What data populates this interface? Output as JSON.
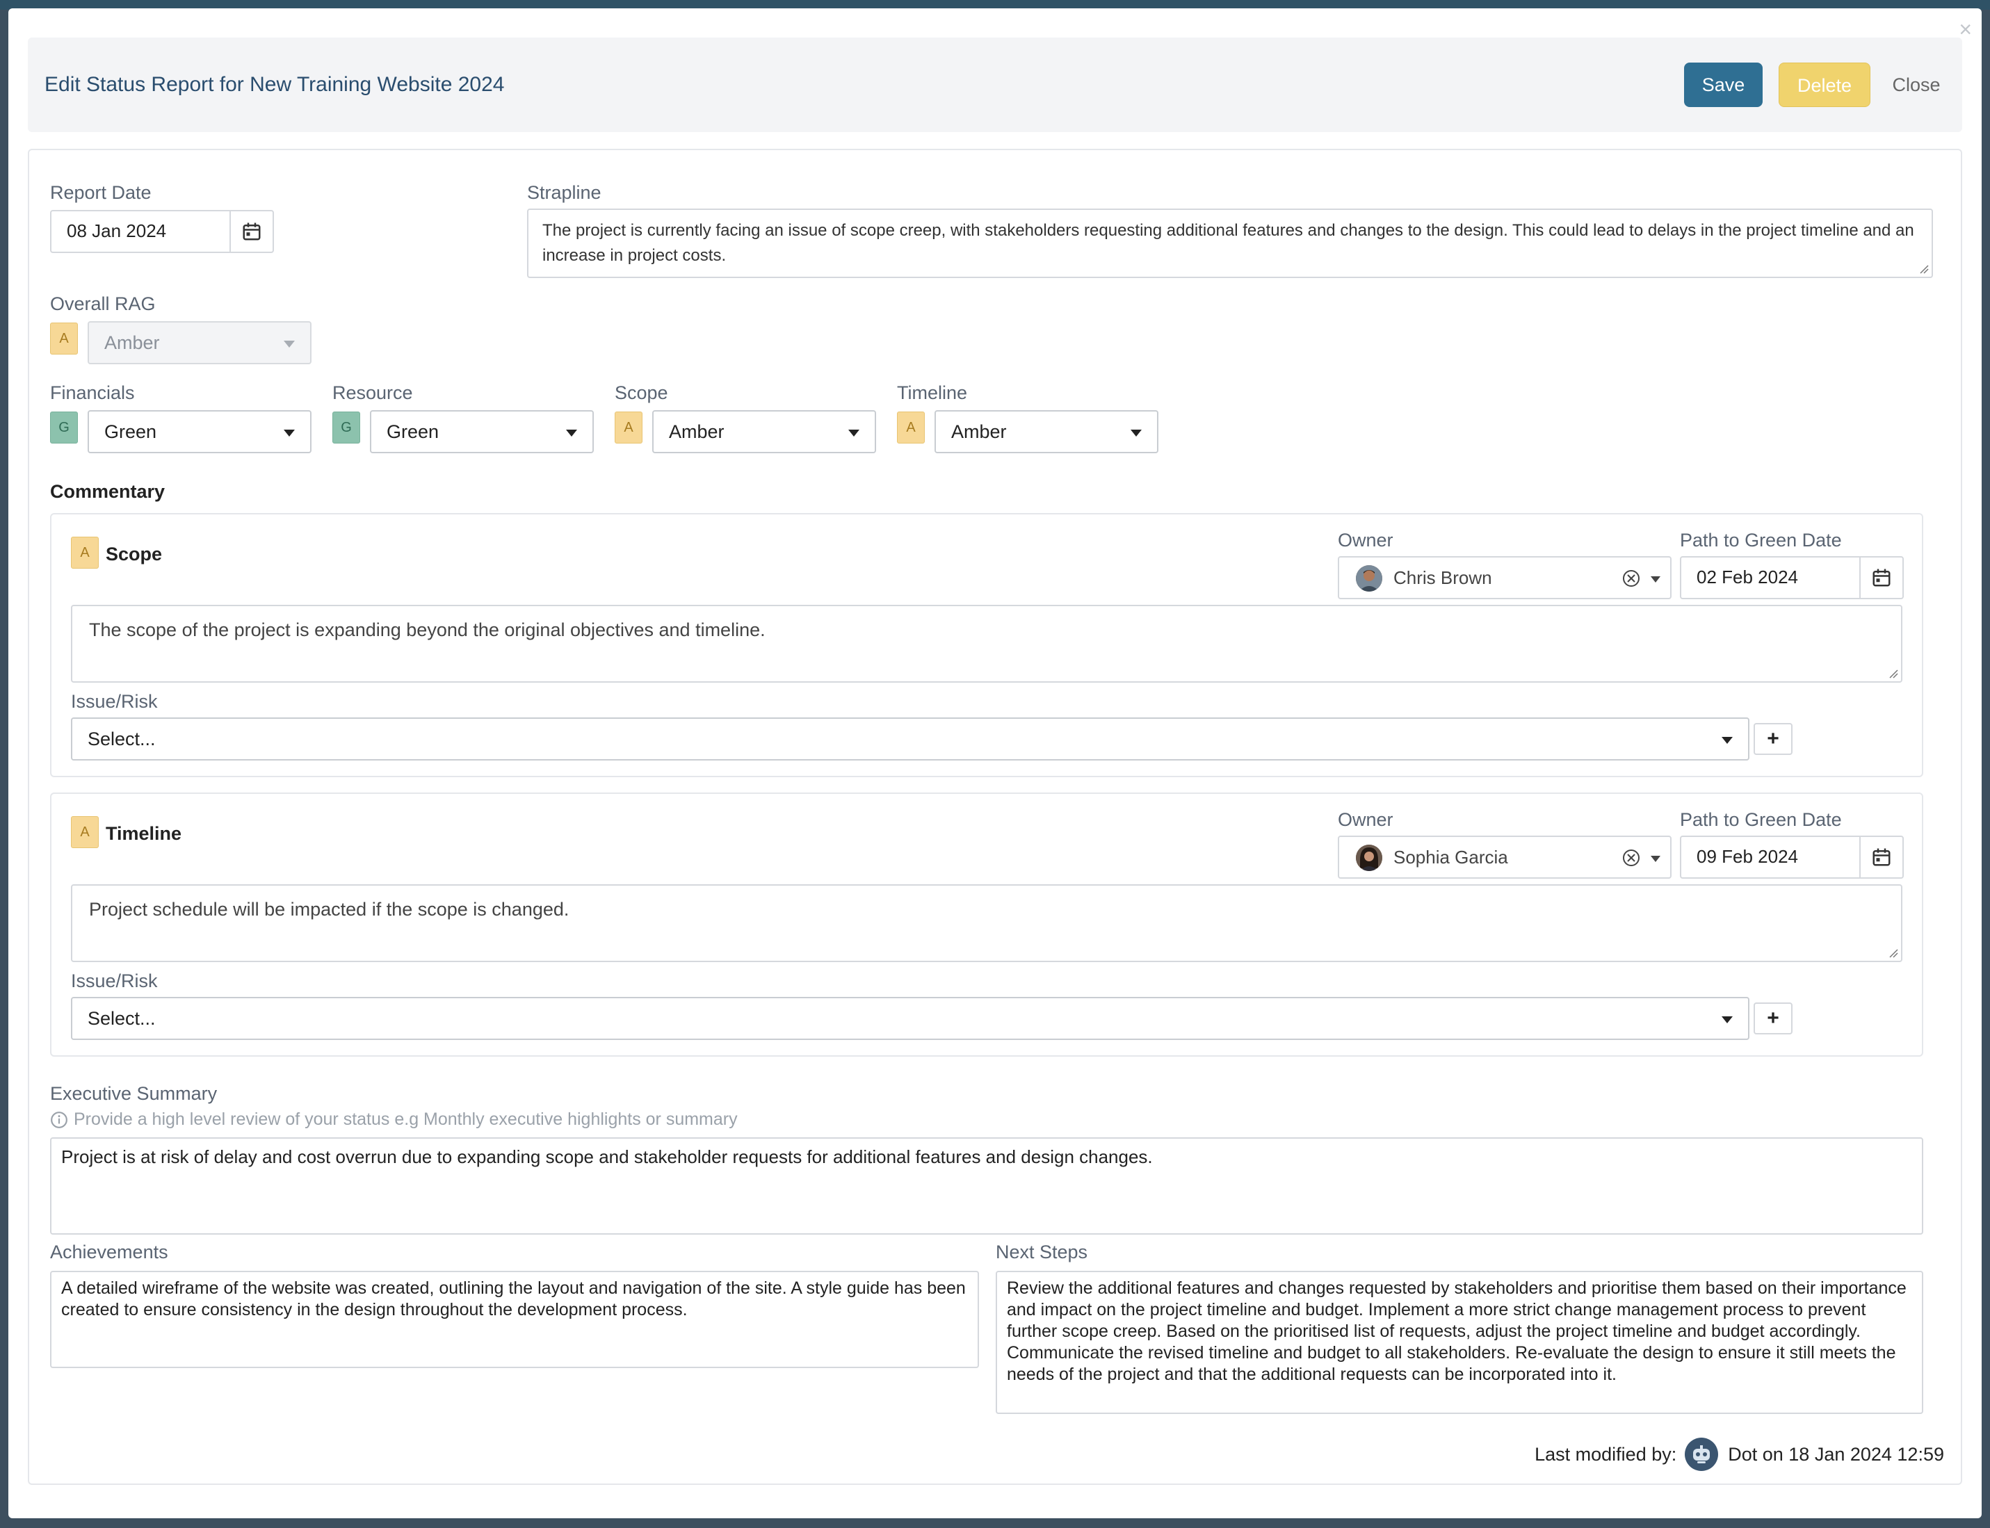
{
  "modal": {
    "title": "Edit Status Report for New Training Website 2024",
    "save_label": "Save",
    "delete_label": "Delete",
    "close_label": "Close",
    "close_icon": "×"
  },
  "report": {
    "report_date_label": "Report Date",
    "report_date_value": "08 Jan 2024",
    "strapline_label": "Strapline",
    "strapline_value": "The project is currently facing an issue of scope creep, with stakeholders requesting additional features and changes to the design. This could lead to delays in the project timeline and an increase in project costs.",
    "overall_rag_label": "Overall RAG",
    "overall_rag_badge": "A",
    "overall_rag_value": "Amber"
  },
  "rags": [
    {
      "label": "Financials",
      "badge": "G",
      "value": "Green"
    },
    {
      "label": "Resource",
      "badge": "G",
      "value": "Green"
    },
    {
      "label": "Scope",
      "badge": "A",
      "value": "Amber"
    },
    {
      "label": "Timeline",
      "badge": "A",
      "value": "Amber"
    }
  ],
  "commentary": {
    "heading": "Commentary",
    "owner_label": "Owner",
    "path_label": "Path to Green Date",
    "issue_label": "Issue/Risk",
    "issue_placeholder": "Select...",
    "plus": "+",
    "items": [
      {
        "badge": "A",
        "title": "Scope",
        "owner": "Chris Brown",
        "path_date": "02 Feb 2024",
        "comment": "The scope of the project is expanding beyond the original objectives and timeline."
      },
      {
        "badge": "A",
        "title": "Timeline",
        "owner": "Sophia Garcia",
        "path_date": "09 Feb 2024",
        "comment": "Project schedule will be impacted if the scope is changed."
      }
    ]
  },
  "summary": {
    "exec_label": "Executive Summary",
    "exec_hint": "Provide a high level review of your status e.g Monthly executive highlights or summary",
    "exec_value": "Project is at risk of delay and cost overrun due to expanding scope and stakeholder requests for additional features and design changes.",
    "achievements_label": "Achievements",
    "achievements_value": "A detailed wireframe of the website was created, outlining the layout and navigation of the site. A style guide has been created to ensure consistency in the design throughout the development process.",
    "next_steps_label": "Next Steps",
    "next_steps_value": "Review the additional features and changes requested by stakeholders and prioritise them based on their importance and impact on the project timeline and budget. Implement a more strict change management process to prevent further scope creep. Based on the prioritised list of requests, adjust the project timeline and budget accordingly. Communicate the revised timeline and budget to all stakeholders. Re-evaluate the design to ensure it still meets the needs of the project and that the additional requests can be incorporated into it."
  },
  "footer": {
    "modified_label": "Last modified by:",
    "modified_value": "Dot on 18 Jan 2024 12:59"
  },
  "colors": {
    "primary": "#2f6f93",
    "warning": "#f0d36d",
    "amber": "#f7d896",
    "green": "#8cc2ad",
    "title": "#2a4d6e"
  }
}
